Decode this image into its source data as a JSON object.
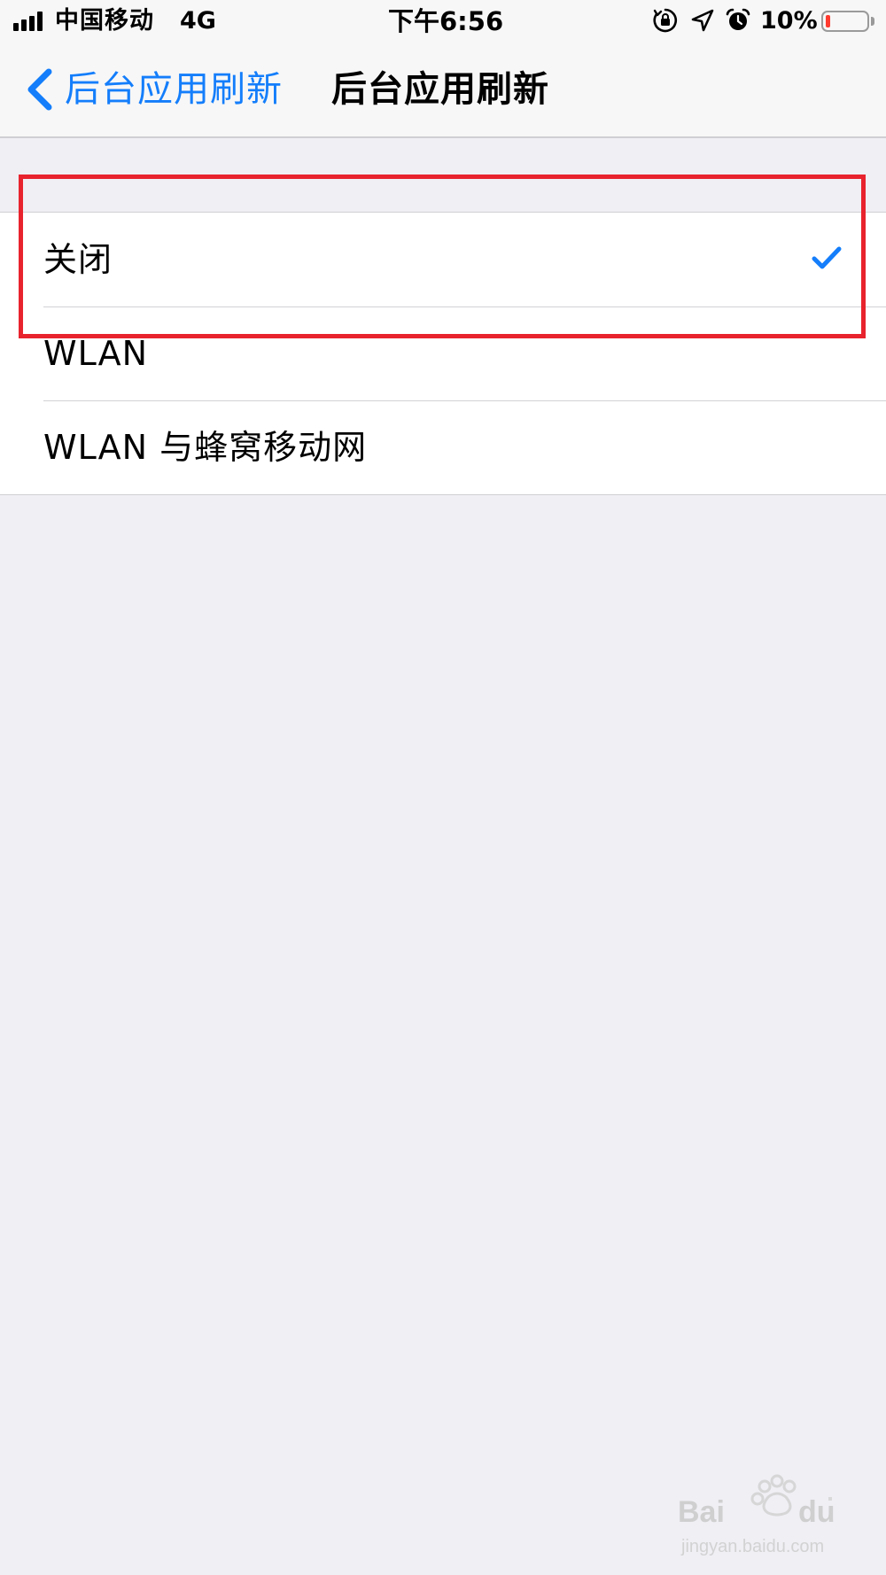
{
  "status_bar": {
    "carrier": "中国移动",
    "network": "4G",
    "time": "下午6:56",
    "battery_percent": "10%",
    "battery_level": 0.1,
    "icons": [
      "signal-icon",
      "orientation-lock-icon",
      "location-icon",
      "alarm-icon",
      "battery-icon"
    ]
  },
  "nav_bar": {
    "back_label": "后台应用刷新",
    "title": "后台应用刷新"
  },
  "options": [
    {
      "label": "关闭",
      "selected": true
    },
    {
      "label": "WLAN",
      "selected": false
    },
    {
      "label": "WLAN 与蜂窝移动网",
      "selected": false
    }
  ],
  "colors": {
    "accent": "#147efb",
    "background": "#efeff4",
    "highlight": "#e8232d",
    "battery_low": "#ff3b30"
  }
}
